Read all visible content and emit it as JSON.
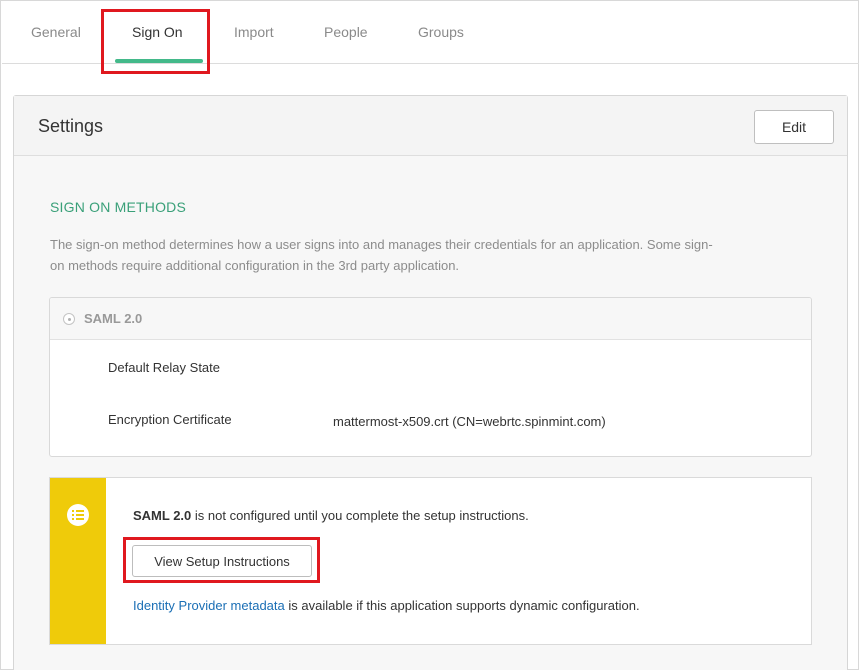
{
  "tabs": [
    {
      "label": "General"
    },
    {
      "label": "Sign On"
    },
    {
      "label": "Import"
    },
    {
      "label": "People"
    },
    {
      "label": "Groups"
    }
  ],
  "active_tab": "Sign On",
  "settings": {
    "title": "Settings",
    "edit_label": "Edit",
    "section_title": "SIGN ON METHODS",
    "description_line1": "The sign-on method determines how a user signs into and manages their credentials for an application. Some sign-",
    "description_line2": "on methods require additional configuration in the 3rd party application."
  },
  "saml": {
    "method_label": "SAML 2.0",
    "relay_state_label": "Default Relay State",
    "relay_state_value": "",
    "encryption_label": "Encryption Certificate",
    "encryption_value": "mattermost-x509.crt (CN=webrtc.spinmint.com)"
  },
  "notice": {
    "bold_text": "SAML 2.0",
    "text": " is not configured until you complete the setup instructions.",
    "button_label": "View Setup Instructions",
    "link_text": "Identity Provider metadata",
    "footer_text": " is available if this application supports dynamic configuration."
  },
  "colors": {
    "accent_green": "#43b98a",
    "warning_yellow": "#efcb0a",
    "highlight_red": "#e0181f",
    "link_blue": "#1b6fb5"
  },
  "icons": {
    "method_radio": "radio-icon",
    "notice": "list-icon"
  }
}
